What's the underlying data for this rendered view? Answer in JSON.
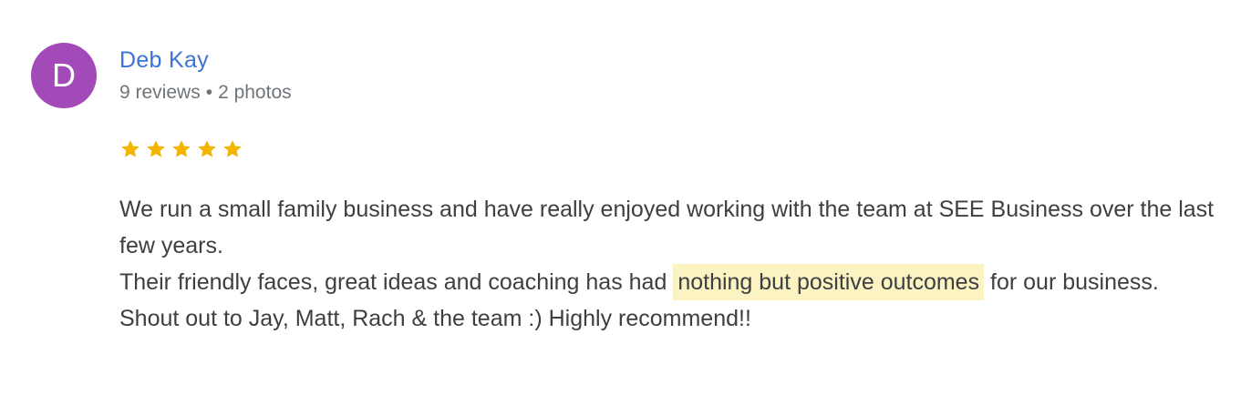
{
  "reviewer": {
    "initial": "D",
    "avatar_color": "#a24bb8",
    "name": "Deb Kay",
    "name_color": "#3b73d6",
    "reviews": "9 reviews",
    "separator": "•",
    "photos": "2 photos"
  },
  "rating": {
    "stars": 5,
    "max": 5,
    "star_color": "#f4b400",
    "icon": "star-icon"
  },
  "review": {
    "line1": "We run a small family business and have really enjoyed working with the team at SEE Business over the last few years.",
    "line2_before": "Their friendly faces, great ideas and coaching has had ",
    "line2_highlight": "nothing but positive outcomes",
    "line2_after": " for our business.",
    "line3": "Shout out to Jay, Matt, Rach & the team :) Highly recommend!!",
    "highlight_color": "#fbf3c2"
  }
}
